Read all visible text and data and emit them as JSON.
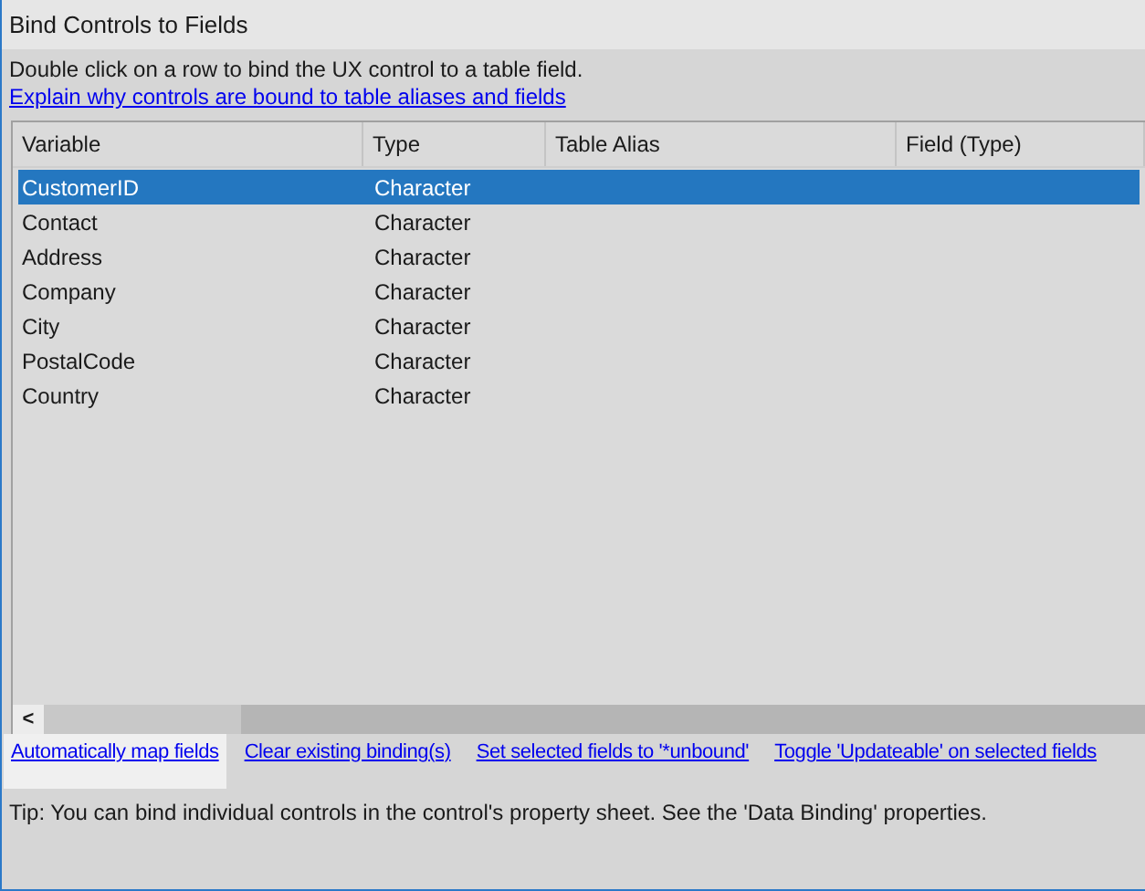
{
  "window": {
    "title": "Bind Controls to Fields"
  },
  "instructions": "Double click on a row to bind the UX control to a table field.",
  "explain_link": "Explain why controls are bound to table aliases and fields",
  "table": {
    "columns": [
      "Variable",
      "Type",
      "Table Alias",
      "Field (Type)"
    ],
    "rows": [
      {
        "cells": [
          "CustomerID",
          "Character"
        ],
        "selected": true
      },
      {
        "cells": [
          "Contact",
          "Character"
        ],
        "selected": false
      },
      {
        "cells": [
          "Address",
          "Character"
        ],
        "selected": false
      },
      {
        "cells": [
          "Company",
          "Character"
        ],
        "selected": false
      },
      {
        "cells": [
          "City",
          "Character"
        ],
        "selected": false
      },
      {
        "cells": [
          "PostalCode",
          "Character"
        ],
        "selected": false
      },
      {
        "cells": [
          "Country",
          "Character"
        ],
        "selected": false
      }
    ]
  },
  "scroll_left": "<",
  "actions": [
    {
      "label": "Automatically map fields",
      "highlighted": true
    },
    {
      "label": "Clear existing binding(s)",
      "highlighted": false
    },
    {
      "label": "Set selected fields to '*unbound'",
      "highlighted": false
    },
    {
      "label": "Toggle 'Updateable' on selected fields",
      "highlighted": false
    }
  ],
  "tip": "Tip: You can bind individual controls in the control's property sheet. See the 'Data Binding' properties."
}
